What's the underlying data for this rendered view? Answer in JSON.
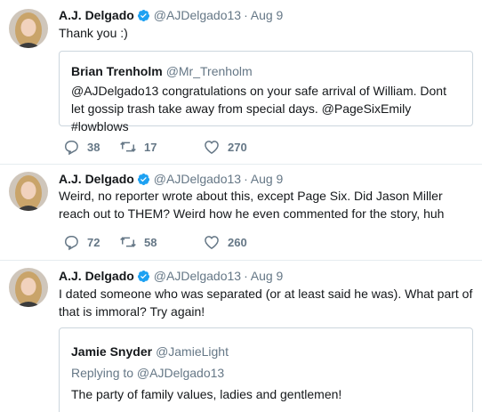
{
  "tweets": [
    {
      "name": "A.J. Delgado",
      "handle": "@AJDelgado13",
      "separator": "·",
      "time": "Aug 9",
      "text": "Thank you :)",
      "quote": {
        "name": "Brian Trenholm",
        "handle": "@Mr_Trenholm",
        "text": "@AJDelgado13 congratulations on your safe arrival of William. Dont let gossip trash take away from special days. @PageSixEmily #lowblows"
      },
      "replies": "38",
      "retweets": "17",
      "likes": "270"
    },
    {
      "name": "A.J. Delgado",
      "handle": "@AJDelgado13",
      "separator": "·",
      "time": "Aug 9",
      "text": "Weird, no reporter wrote about this, except Page Six. Did Jason Miller reach out to THEM? Weird how he even commented for the story, huh",
      "replies": "72",
      "retweets": "58",
      "likes": "260"
    },
    {
      "name": "A.J. Delgado",
      "handle": "@AJDelgado13",
      "separator": "·",
      "time": "Aug 9",
      "text": "I dated someone who was separated (or at least said he was). What part of that is immoral? Try again!",
      "quote": {
        "name": "Jamie Snyder",
        "handle": "@JamieLight",
        "replying_to": "Replying to @AJDelgado13",
        "text": "The party of family values, ladies and gentlemen!"
      }
    }
  ],
  "colors": {
    "name": "#14171a",
    "meta": "#657786",
    "verified": "#1da1f2",
    "divider": "#e6ecf0",
    "quote_border": "#ccd6dd"
  },
  "icons": [
    "avatar",
    "verified-badge-icon",
    "reply-icon",
    "retweet-icon",
    "like-icon"
  ]
}
